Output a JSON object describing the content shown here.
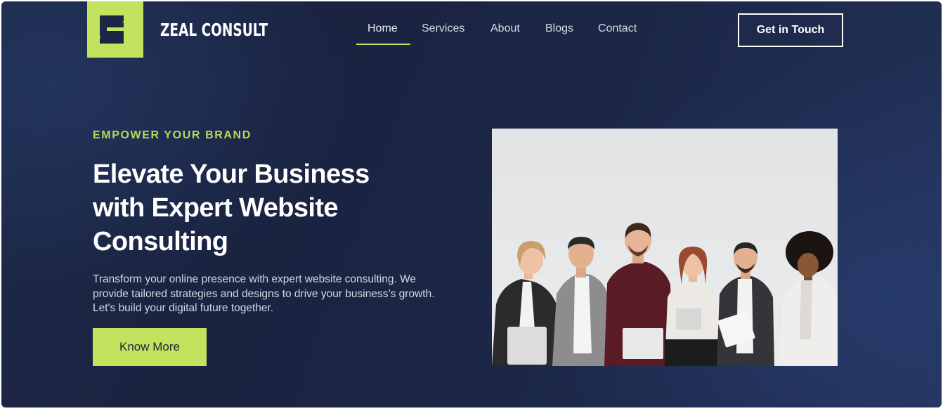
{
  "brand": {
    "name": "ZEAL CONSULT",
    "logo_letter": "Z",
    "logo_color": "#c3e35f"
  },
  "nav": {
    "items": [
      {
        "label": "Home",
        "active": true
      },
      {
        "label": "Services",
        "active": false
      },
      {
        "label": "About",
        "active": false
      },
      {
        "label": "Blogs",
        "active": false
      },
      {
        "label": "Contact",
        "active": false
      }
    ],
    "cta_label": "Get in Touch"
  },
  "hero": {
    "eyebrow": "EMPOWER YOUR BRAND",
    "headline": "Elevate Your Business with Expert Website Consulting",
    "description": "Transform your online presence with expert website consulting. We provide tailored strategies and designs to drive your business’s growth. Let's build your digital future together.",
    "button_label": "Know More",
    "image": "team-photo"
  },
  "colors": {
    "accent": "#c3e35f",
    "background": "#1d2948",
    "text_light": "#ffffff"
  }
}
